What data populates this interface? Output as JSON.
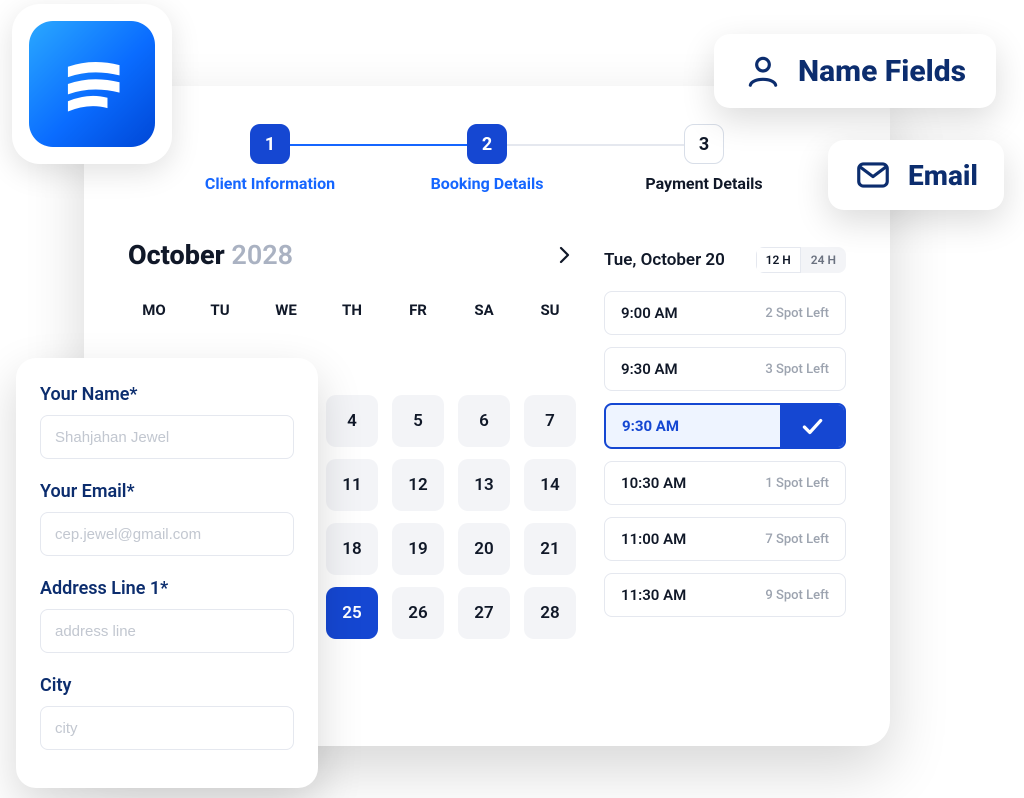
{
  "logo": {
    "name": "fluent-forms-logo"
  },
  "tokens": {
    "name_fields": "Name Fields",
    "email": "Email"
  },
  "stepper": {
    "steps": [
      {
        "num": "1",
        "label": "Client Information",
        "active": true
      },
      {
        "num": "2",
        "label": "Booking Details",
        "active": true
      },
      {
        "num": "3",
        "label": "Payment Details",
        "active": false
      }
    ]
  },
  "calendar": {
    "month": "October",
    "year": "2028",
    "dow": [
      "MO",
      "TU",
      "WE",
      "TH",
      "FR",
      "SA",
      "SU"
    ],
    "cells": [
      "",
      "",
      "",
      "",
      "",
      "",
      "",
      "",
      "",
      "",
      "4",
      "5",
      "6",
      "7",
      "",
      "",
      "",
      "11",
      "12",
      "13",
      "14",
      "",
      "",
      "",
      "18",
      "19",
      "20",
      "21",
      "",
      "",
      "",
      "25",
      "26",
      "27",
      "28"
    ],
    "selected_index": 31
  },
  "slots": {
    "date_label": "Tue, October 20",
    "fmt": {
      "h12": "12 H",
      "h24": "24 H",
      "active": "12"
    },
    "items": [
      {
        "time": "9:00 AM",
        "spots": "2 Spot Left",
        "selected": false
      },
      {
        "time": "9:30 AM",
        "spots": "3 Spot Left",
        "selected": false
      },
      {
        "time": "9:30 AM",
        "spots": "",
        "selected": true
      },
      {
        "time": "10:30 AM",
        "spots": "1 Spot Left",
        "selected": false
      },
      {
        "time": "11:00 AM",
        "spots": "7 Spot Left",
        "selected": false
      },
      {
        "time": "11:30 AM",
        "spots": "9 Spot Left",
        "selected": false
      }
    ]
  },
  "form": {
    "fields": [
      {
        "label": "Your Name*",
        "placeholder": "Shahjahan Jewel"
      },
      {
        "label": "Your Email*",
        "placeholder": "cep.jewel@gmail.com"
      },
      {
        "label": "Address Line 1*",
        "placeholder": "address line"
      },
      {
        "label": "City",
        "placeholder": "city"
      }
    ]
  }
}
